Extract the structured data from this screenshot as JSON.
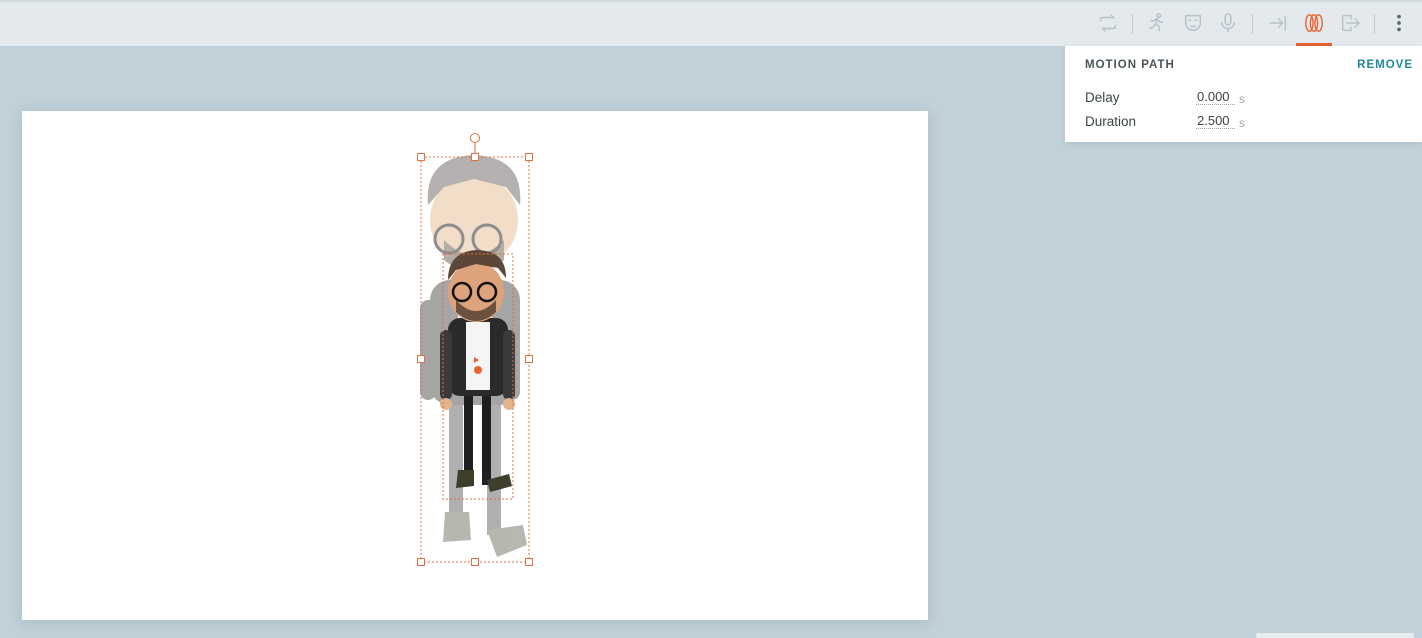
{
  "toolbar": {
    "buttons": [
      {
        "name": "loop-icon"
      },
      {
        "name": "run-animation-icon"
      },
      {
        "name": "mask-icon"
      },
      {
        "name": "microphone-icon"
      },
      {
        "name": "enter-icon"
      },
      {
        "name": "motion-path-icon",
        "active": true
      },
      {
        "name": "exit-icon"
      },
      {
        "name": "more-vertical-icon"
      }
    ],
    "accent_color": "#e8632f"
  },
  "motion_panel": {
    "title": "MOTION PATH",
    "remove_label": "REMOVE",
    "delay_label": "Delay",
    "delay_value": "0.000",
    "delay_unit": "s",
    "duration_label": "Duration",
    "duration_value": "2.500",
    "duration_unit": "s"
  },
  "colors": {
    "background": "#c1d1d9",
    "canvas": "#ffffff",
    "selection": "#e07040",
    "remove_link": "#1f8a96"
  }
}
